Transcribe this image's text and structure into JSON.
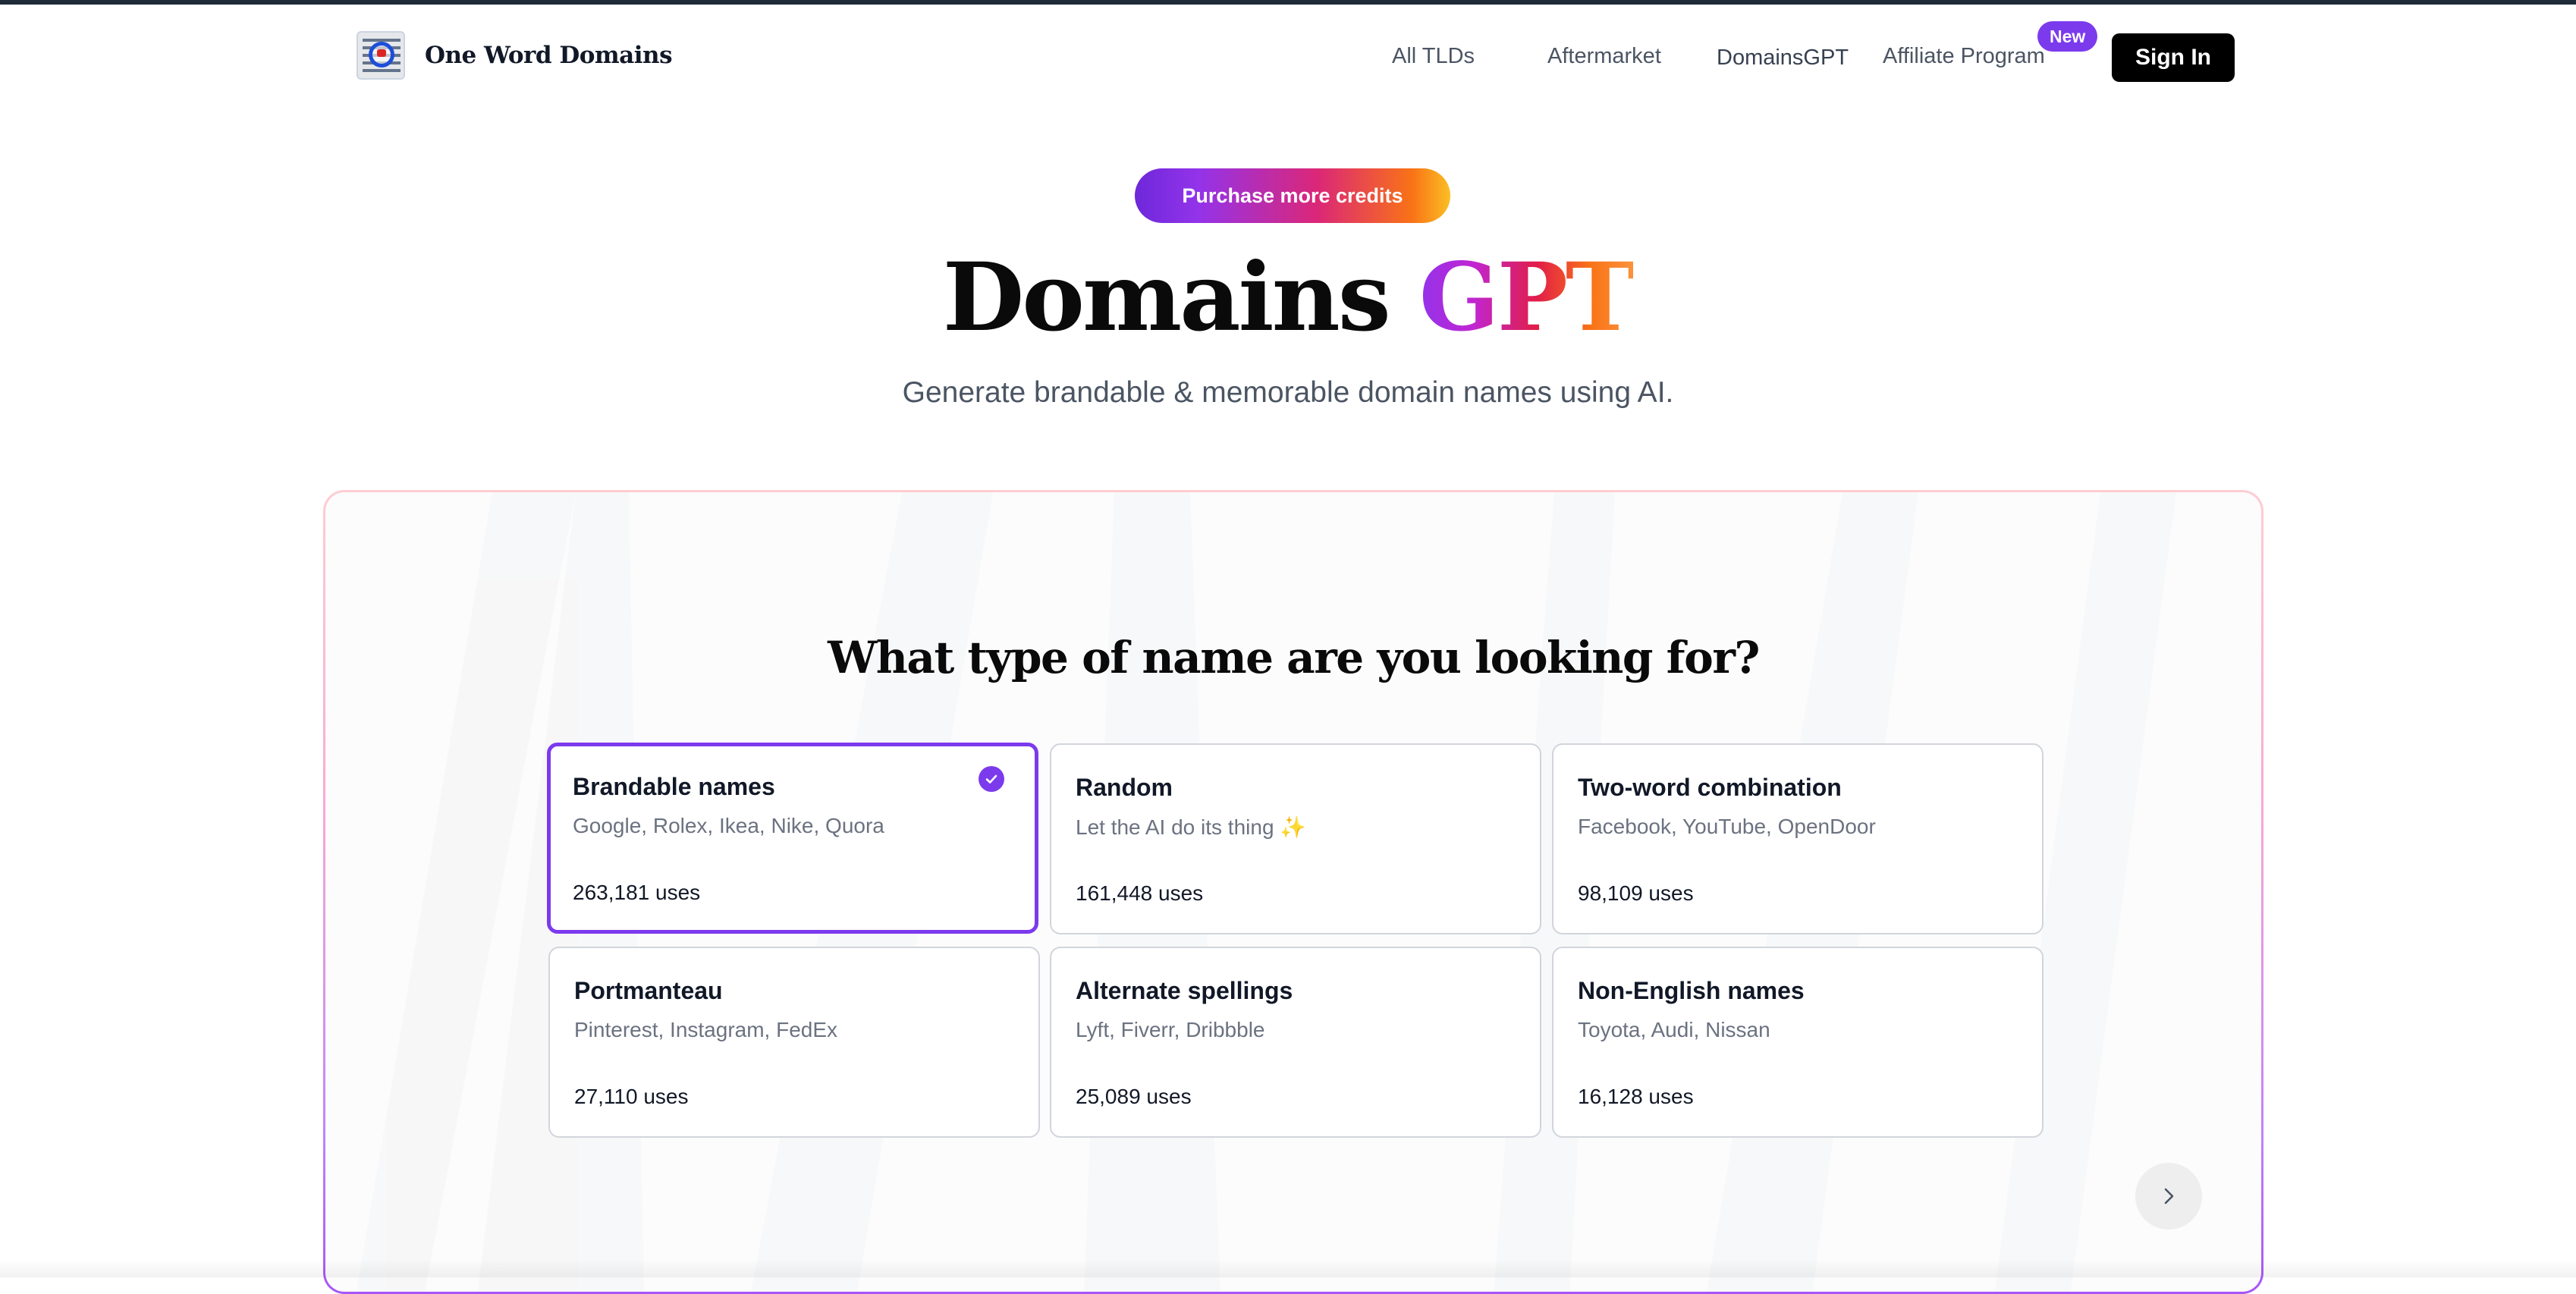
{
  "header": {
    "brand": "One Word Domains",
    "nav": {
      "all_tlds": "All TLDs",
      "aftermarket": "Aftermarket",
      "domainsgpt": "DomainsGPT",
      "affiliate": "Affiliate Program",
      "new_badge": "New"
    },
    "sign_in": "Sign In"
  },
  "hero": {
    "credits_button": "Purchase more credits",
    "title_main": "Domains",
    "title_accent": "GPT",
    "subtitle": "Generate brandable & memorable domain names using AI."
  },
  "panel": {
    "heading": "What type of name are you looking for?",
    "cards": [
      {
        "title": "Brandable names",
        "desc": "Google, Rolex, Ikea, Nike, Quora",
        "uses": "263,181 uses",
        "selected": true
      },
      {
        "title": "Random",
        "desc": "Let the AI do its thing",
        "sparkle": "✨",
        "uses": "161,448 uses",
        "selected": false
      },
      {
        "title": "Two-word combination",
        "desc": "Facebook, YouTube, OpenDoor",
        "uses": "98,109 uses",
        "selected": false
      },
      {
        "title": "Portmanteau",
        "desc": "Pinterest, Instagram, FedEx",
        "uses": "27,110 uses",
        "selected": false
      },
      {
        "title": "Alternate spellings",
        "desc": "Lyft, Fiverr, Dribbble",
        "uses": "25,089 uses",
        "selected": false
      },
      {
        "title": "Non-English names",
        "desc": "Toyota, Audi, Nissan",
        "uses": "16,128 uses",
        "selected": false
      }
    ]
  },
  "colors": {
    "accent": "#7c3aed",
    "gradient_start": "#9333ea",
    "gradient_mid": "#e11d48",
    "gradient_end": "#f97316"
  },
  "icons": {
    "check": "check-circle-icon",
    "next": "chevron-right-icon",
    "logo": "logo-icon"
  }
}
